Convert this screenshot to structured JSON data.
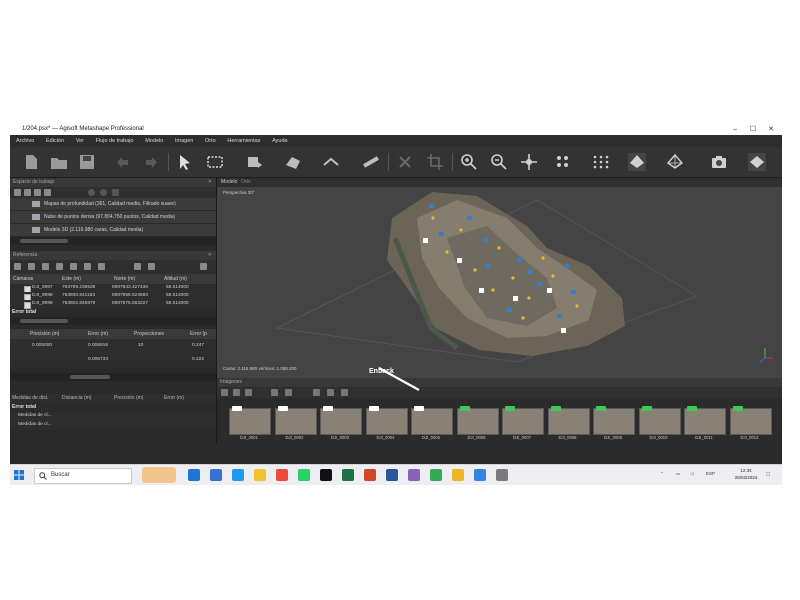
{
  "window": {
    "title": "1/204.psx* — Agisoft Metashape Professional",
    "controls": [
      "–",
      "☐",
      "✕"
    ]
  },
  "menu": [
    "Archivo",
    "Edición",
    "Ver",
    "Flujo de trabajo",
    "Modelo",
    "Imagen",
    "Orto",
    "Herramientas",
    "Ayuda"
  ],
  "toolbar": {
    "icons": [
      "new-document-icon",
      "open-folder-icon",
      "save-icon",
      "undo-icon",
      "redo-icon",
      "pointer-icon",
      "rectangle-selection-icon",
      "model-navigation-icon",
      "shape-icon",
      "ruler-line-icon",
      "measure-icon",
      "delete-icon",
      "crop-icon",
      "zoom-in-icon",
      "zoom-out-icon",
      "move-icon",
      "points-icon",
      "grid-points-icon",
      "model-icon",
      "wireframe-icon",
      "camera-icon",
      "tie-points-icon"
    ]
  },
  "workspace": {
    "header": "Espacio de trabajo",
    "chunks": [
      "Mapas de profundidad (361, Calidad media, Filtrado suave)",
      "Nube de puntos densa (97.804.750 puntos, Calidad media)",
      "Modelo 3D (2.116.980 caras, Calidad media)"
    ]
  },
  "reference": {
    "header": "Referencia",
    "columns": [
      "Cámaras",
      "Este (m)",
      "Norte (m)",
      "Altitud (m)"
    ],
    "rows": [
      {
        "name": "DJI_0997",
        "este": "763799.236539",
        "norte": "8987943.427436",
        "alt": "58.514000"
      },
      {
        "name": "DJI_0998",
        "este": "763800.941183",
        "norte": "8987958.524593",
        "alt": "58.514000"
      },
      {
        "name": "DJI_0999",
        "este": "763802.845879",
        "norte": "8987975.553227",
        "alt": "58.514000"
      }
    ],
    "total_label": "Error total",
    "sub_columns": [
      "Precisión (m)",
      "Error (m)",
      "Proyecciones",
      "Error (p"
    ],
    "sub_row": {
      "precision": "0.005000",
      "error": "0.006916",
      "proj": "10",
      "err_p": "0.247"
    },
    "sub_row2": {
      "error": "0.006733",
      "err_p": "0.222"
    }
  },
  "bottom_tabs": [
    "Medidas de dist.",
    "Distancia (m)",
    "Precisión (m)",
    "Error (m)"
  ],
  "bottom_total": "Error total",
  "bottom_items": [
    "Medidas de cl...",
    "Medidas de cl..."
  ],
  "viewport": {
    "tabs": [
      "Modelo",
      "Orto"
    ],
    "label": "Perspectiva 30°",
    "info": "Caras: 2.116.980 vértices: 1.058.200"
  },
  "photos": {
    "header": "Imágenes",
    "items": [
      {
        "name": "DJI_0001",
        "flag": "white"
      },
      {
        "name": "DJI_0002",
        "flag": "white"
      },
      {
        "name": "DJI_0003",
        "flag": "white"
      },
      {
        "name": "DJI_0004",
        "flag": "white"
      },
      {
        "name": "DJI_0005",
        "flag": "white"
      },
      {
        "name": "DJI_0006",
        "flag": "green"
      },
      {
        "name": "DJI_0007",
        "flag": "green"
      },
      {
        "name": "DJI_0008",
        "flag": "green"
      },
      {
        "name": "DJI_0009",
        "flag": "green"
      },
      {
        "name": "DJI_0010",
        "flag": "green"
      },
      {
        "name": "DJI_0011",
        "flag": "green"
      },
      {
        "name": "DJI_0012",
        "flag": "green"
      }
    ]
  },
  "annotation": {
    "text": "Enback"
  },
  "taskbar": {
    "search_placeholder": "Buscar",
    "lang": "ESP",
    "time": "12:34",
    "date": "25/03/2024",
    "app_icons": [
      "file-explorer-icon",
      "store-icon",
      "mail-icon",
      "folder-icon",
      "chrome-icon",
      "whatsapp-icon",
      "tiktok-icon",
      "excel-icon",
      "powerpoint-icon",
      "word-icon",
      "media-icon",
      "chrome-icon-2",
      "photos-icon",
      "metashape-icon",
      "settings-icon"
    ],
    "icon_colors": [
      "#1e74d2",
      "#3b6fd4",
      "#1f9af0",
      "#f2c12e",
      "#e74c3c",
      "#25d366",
      "#111111",
      "#1e7145",
      "#d24726",
      "#2b579a",
      "#8764b8",
      "#34a853",
      "#f0b429",
      "#2e86de",
      "#7a7a7a"
    ]
  }
}
